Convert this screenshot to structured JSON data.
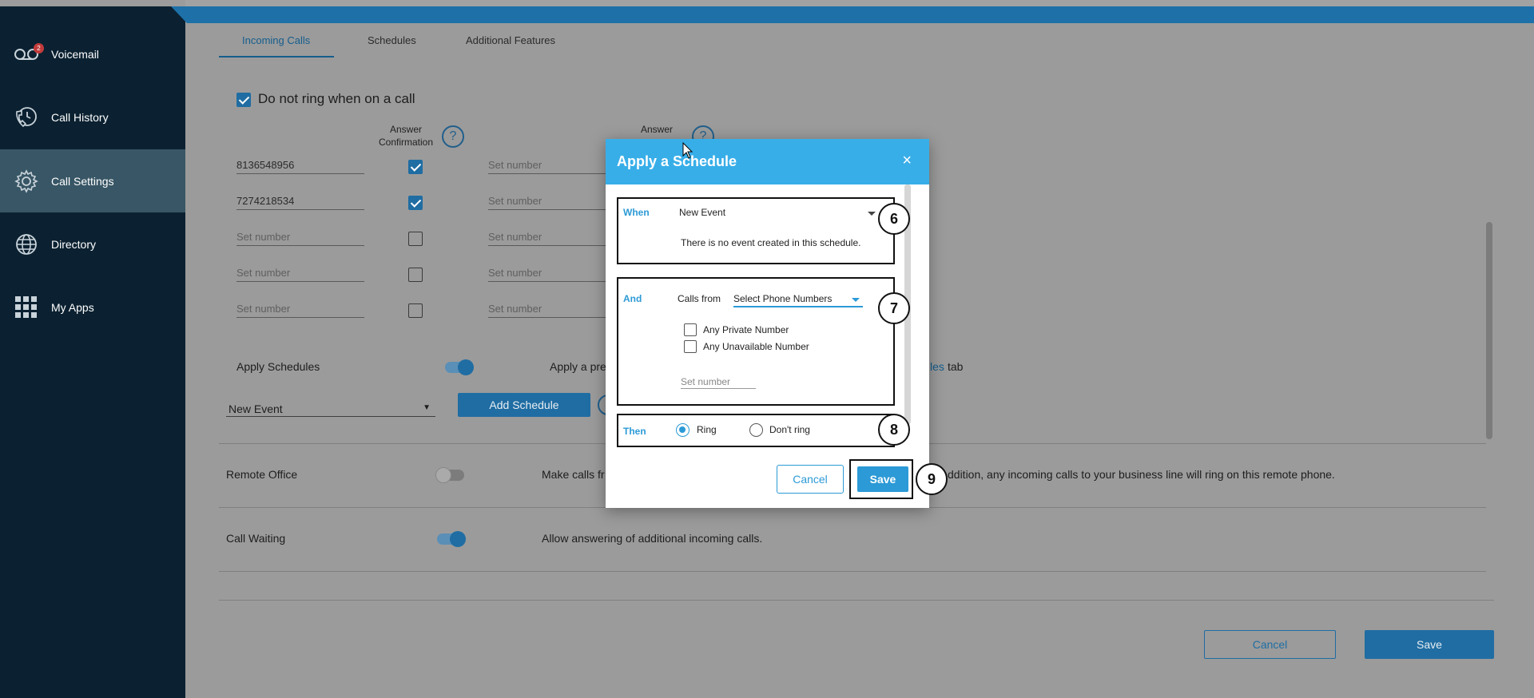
{
  "sidebar": {
    "items": [
      {
        "label": "Voicemail",
        "icon": "voicemail-icon",
        "badge": "2"
      },
      {
        "label": "Call History",
        "icon": "phone-clock-icon"
      },
      {
        "label": "Call Settings",
        "icon": "gear-icon"
      },
      {
        "label": "Directory",
        "icon": "globe-icon"
      },
      {
        "label": "My Apps",
        "icon": "grid-icon"
      }
    ]
  },
  "tabs": [
    "Incoming Calls",
    "Schedules",
    "Additional Features"
  ],
  "incoming": {
    "dnr_label": "Do not ring when on a call",
    "col_answer_confirm_1": "Answer",
    "col_answer_confirm_2": "Confirmation",
    "col_answer_2": "Answer",
    "help": "?",
    "numbers": [
      "8136548956",
      "7274218534",
      "Set number",
      "Set number",
      "Set number"
    ],
    "confirm_checked": [
      true,
      true,
      false,
      false,
      false
    ],
    "right_numbers": [
      "Set number",
      "Set number",
      "Set number",
      "Set number",
      "Set number"
    ]
  },
  "apply_schedules": {
    "label": "Apply Schedules",
    "desc_prefix": "Apply a pre",
    "desc_link": "les",
    "desc_suffix": "tab",
    "select_value": "New Event",
    "add_button": "Add Schedule"
  },
  "remote_office": {
    "label": "Remote Office",
    "desc_left": "Make calls fr",
    "desc_right": "ddition, any incoming calls to your business line will ring on this remote phone."
  },
  "call_waiting": {
    "label": "Call Waiting",
    "desc": "Allow answering of additional incoming calls."
  },
  "footer": {
    "cancel": "Cancel",
    "save": "Save"
  },
  "modal": {
    "title": "Apply a Schedule",
    "close": "×",
    "when": {
      "label": "When",
      "select": "New Event",
      "message": "There is no event created in this schedule."
    },
    "and": {
      "label": "And",
      "calls_from": "Calls from",
      "select": "Select Phone Numbers",
      "opt1": "Any Private Number",
      "opt2": "Any Unavailable Number",
      "set_number": "Set number"
    },
    "then": {
      "label": "Then",
      "ring": "Ring",
      "dont_ring": "Don't ring"
    },
    "cancel": "Cancel",
    "save": "Save",
    "callouts": [
      "6",
      "7",
      "8",
      "9"
    ]
  },
  "colors": {
    "sidebar_bg": "#0b2131",
    "sidebar_active": "#385665",
    "header_blue": "#38aee8",
    "accent": "#2c9ad6",
    "dim_bg": "#9b9b9b"
  }
}
